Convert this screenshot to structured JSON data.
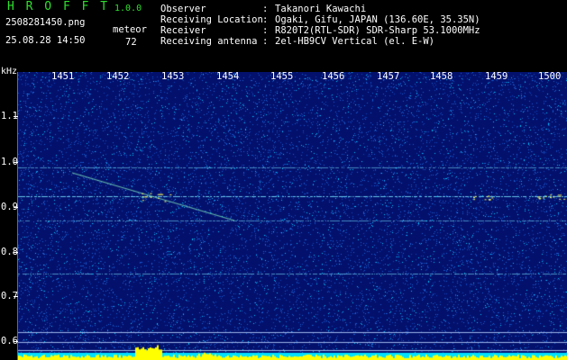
{
  "header": {
    "app_title": "H R O F F T",
    "version": "1.0.0",
    "filename": "2508281450.png",
    "datetime": "25.08.28 14:50",
    "meteor_label": "meteor",
    "meteor_count": "72",
    "info": [
      {
        "label": "Observer",
        "value": "Takanori Kawachi"
      },
      {
        "label": "Receiving Location",
        "value": "Ogaki, Gifu, JAPAN (136.60E, 35.35N)"
      },
      {
        "label": "Receiver",
        "value": "R820T2(RTL-SDR) SDR-Sharp 53.1000MHz"
      },
      {
        "label": "Receiving antenna",
        "value": "2el-HB9CV Vertical (el. E-W)"
      }
    ],
    "colon": ":"
  },
  "spectrogram": {
    "y_unit": "kHz",
    "time_labels": [
      "1451",
      "1452",
      "1453",
      "1454",
      "1455",
      "1456",
      "1457",
      "1458",
      "1459",
      "1500"
    ],
    "freq_labels": [
      "1.1",
      "1.0",
      "0.9",
      "0.8",
      "0.7",
      "0.6"
    ],
    "colors": {
      "background": "#03116d",
      "noise_bright": "#00c8ff",
      "noise_mid": "#1b5fd0",
      "echo": "#ffff60",
      "level_bar": "#ffff00",
      "base_cyan": "#00e0ff"
    }
  }
}
